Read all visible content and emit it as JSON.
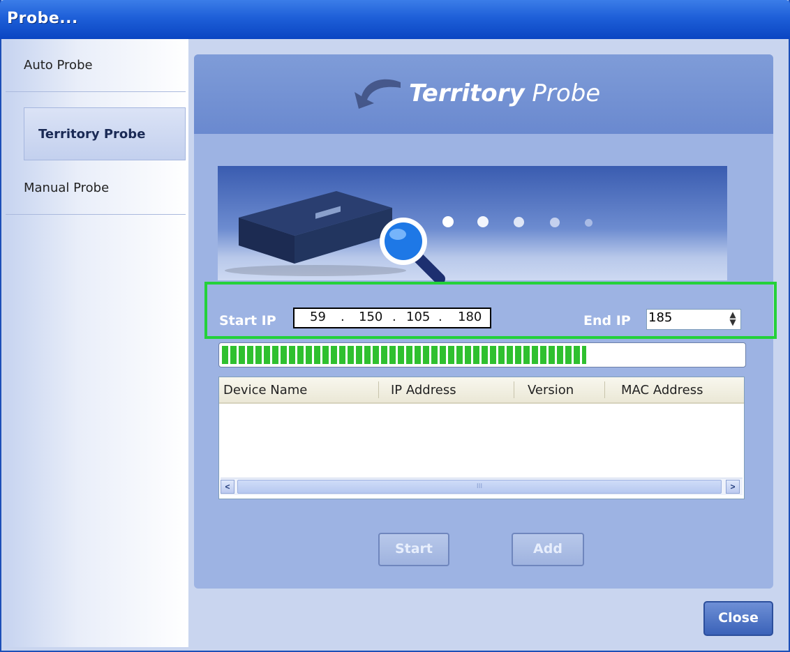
{
  "window": {
    "title": "Probe..."
  },
  "sidebar": {
    "items": [
      {
        "label": "Auto Probe",
        "active": false
      },
      {
        "label": "Territory Probe",
        "active": true
      },
      {
        "label": "Manual Probe",
        "active": false
      }
    ]
  },
  "panel": {
    "title_bold": "Territory",
    "title_regular": "Probe",
    "start_ip_label": "Start IP",
    "start_ip": [
      "59",
      "150",
      "105",
      "180"
    ],
    "ip_separator": ".",
    "end_ip_label": "End IP",
    "end_ip": "185",
    "progress_percent": 70
  },
  "table": {
    "columns": [
      "Device Name",
      "IP Address",
      "Version",
      "MAC Address"
    ],
    "rows": [],
    "scrollbar_grip": "III"
  },
  "buttons": {
    "start": "Start",
    "add": "Add",
    "close": "Close"
  },
  "colors": {
    "highlight": "#24d13a",
    "progress": "#2fc02f",
    "titlebar": "#1e5fd8"
  },
  "icons": {
    "back": "curved-arrow-icon",
    "search": "magnifier-icon",
    "device": "network-device-icon"
  }
}
